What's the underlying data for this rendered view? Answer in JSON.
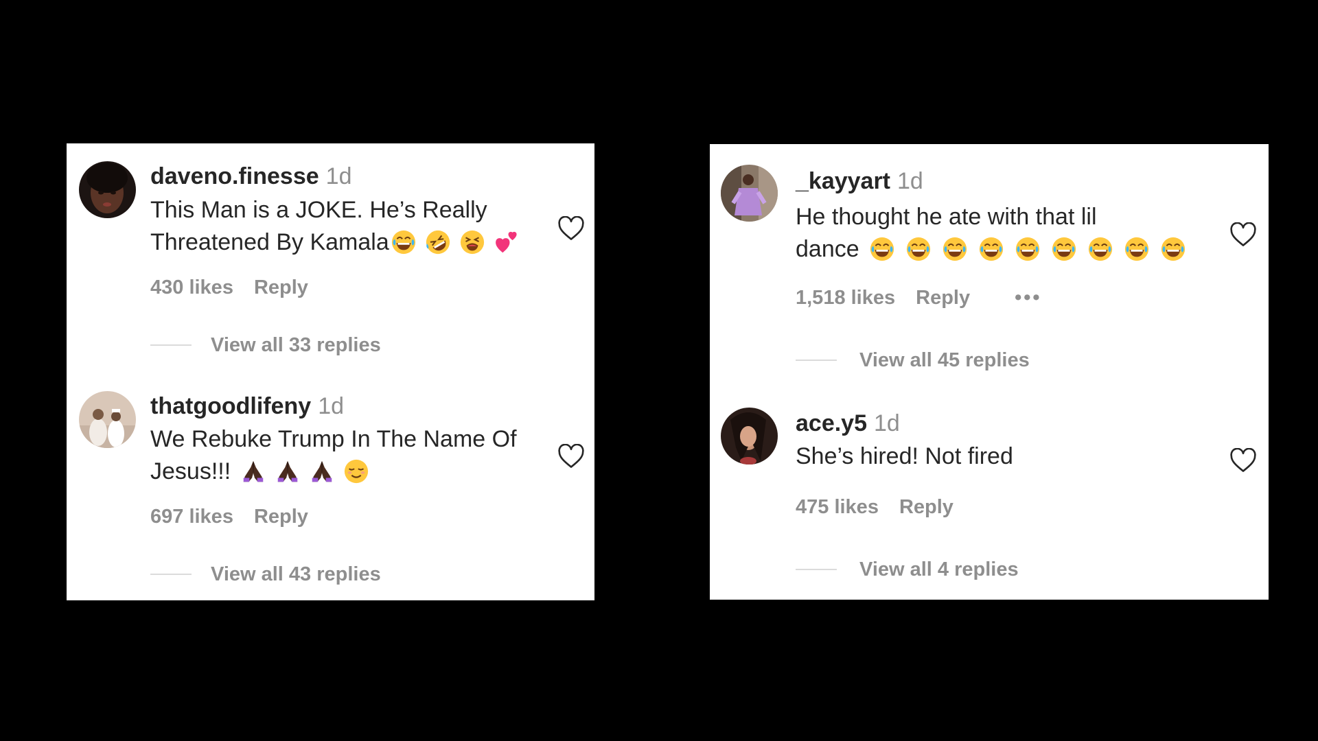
{
  "panels": {
    "left": {
      "comments": [
        {
          "username": "daveno.finesse",
          "time": "1d",
          "text_line1": "This Man is a JOKE. He’s Really",
          "text_line2": "Threatened By Kamala",
          "emojis": [
            "joy-emoji",
            "rofl-emoji",
            "tired-face-emoji",
            "two-hearts-emoji"
          ],
          "likes": "430 likes",
          "reply": "Reply",
          "view_replies": "View all 33 replies"
        },
        {
          "username": "thatgoodlifeny",
          "time": "1d",
          "text_line1": "We Rebuke Trump In The Name Of",
          "text_line2": "Jesus!!!",
          "emojis": [
            "praying-hands-emoji",
            "praying-hands-emoji",
            "praying-hands-emoji",
            "relieved-face-emoji"
          ],
          "likes": "697 likes",
          "reply": "Reply",
          "view_replies": "View all 43 replies"
        }
      ]
    },
    "right": {
      "comments": [
        {
          "username": "_kayyart",
          "time": "1d",
          "text_line1": "He thought he ate with that lil",
          "text_line2": "dance",
          "emojis": [
            "joy-emoji",
            "joy-emoji",
            "joy-emoji",
            "joy-emoji",
            "joy-emoji",
            "joy-emoji",
            "joy-emoji",
            "joy-emoji",
            "joy-emoji"
          ],
          "likes": "1,518 likes",
          "reply": "Reply",
          "more": "•••",
          "view_replies": "View all 45 replies"
        },
        {
          "username": "ace.y5",
          "time": "1d",
          "text_line1": "She’s hired! Not fired",
          "likes": "475 likes",
          "reply": "Reply",
          "view_replies": "View all 4 replies"
        }
      ]
    }
  },
  "colors": {
    "background": "#000000",
    "panel": "#ffffff",
    "username": "#262626",
    "secondary": "#8e8e8e"
  }
}
